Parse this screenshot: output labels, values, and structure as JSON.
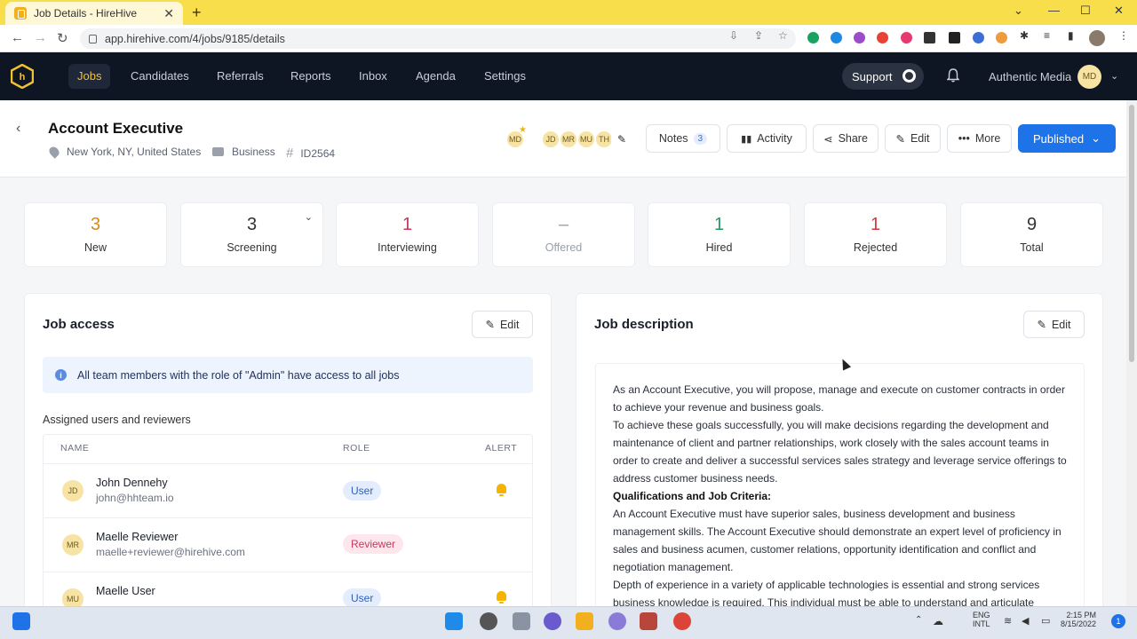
{
  "browser": {
    "tab_title": "Job Details - HireHive",
    "url": "app.hirehive.com/4/jobs/9185/details"
  },
  "nav": {
    "items": [
      "Jobs",
      "Candidates",
      "Referrals",
      "Reports",
      "Inbox",
      "Agenda",
      "Settings"
    ],
    "support_label": "Support",
    "org_name": "Authentic Media",
    "user_initials": "MD",
    "accent": "#f5c02f"
  },
  "job": {
    "title": "Account Executive",
    "location": "New York, NY, United States",
    "department": "Business",
    "job_id": "ID2564",
    "hiring_team": [
      "MD",
      "JD",
      "MR",
      "MU",
      "TH"
    ],
    "notes_label": "Notes",
    "notes_count": "3",
    "activity_label": "Activity",
    "share_label": "Share",
    "edit_label": "Edit",
    "more_label": "More",
    "status_label": "Published"
  },
  "pipeline": [
    {
      "count": "3",
      "label": "New",
      "color": "#d68a1c"
    },
    {
      "count": "3",
      "label": "Screening",
      "color": "#333333"
    },
    {
      "count": "1",
      "label": "Interviewing",
      "color": "#c7375b"
    },
    {
      "count": "–",
      "label": "Offered",
      "color": "#9aa0aa"
    },
    {
      "count": "1",
      "label": "Hired",
      "color": "#1f9a63"
    },
    {
      "count": "1",
      "label": "Rejected",
      "color": "#d23b3b"
    },
    {
      "count": "9",
      "label": "Total",
      "color": "#333333"
    }
  ],
  "job_access": {
    "title": "Job access",
    "edit_label": "Edit",
    "info": "All team members with the role of \"Admin\" have access to all jobs",
    "subtitle": "Assigned users and reviewers",
    "columns": [
      "NAME",
      "ROLE",
      "ALERT"
    ],
    "users": [
      {
        "initials": "JD",
        "name": "John Dennehy",
        "email": "john@hhteam.io",
        "role": "User"
      },
      {
        "initials": "MR",
        "name": "Maelle Reviewer",
        "email": "maelle+reviewer@hirehive.com",
        "role": "Reviewer"
      },
      {
        "initials": "MU",
        "name": "Maelle User",
        "email": "",
        "role": "User"
      }
    ]
  },
  "job_description": {
    "title": "Job description",
    "edit_label": "Edit",
    "p1": "As an Account Executive, you will propose, manage and execute on customer contracts in order to achieve your revenue and business goals.",
    "p2": "To achieve these goals successfully, you will make decisions regarding the development and maintenance of client and partner relationships, work closely with the sales account teams in order to create and deliver a successful services sales strategy and leverage service offerings to address customer business needs.",
    "heading": "Qualifications and Job Criteria:",
    "p3": "An Account Executive must have superior sales, business development and business management skills. The Account Executive should demonstrate an expert level of proficiency in sales and business acumen, customer relations, opportunity identification and conflict and negotiation management.",
    "p4": "Depth of experience in a variety of applicable technologies is essential and strong services business knowledge is required. This individual must be able to understand and articulate"
  },
  "taskbar": {
    "language": "ENG",
    "layout": "INTL",
    "time": "2:15 PM",
    "date": "8/15/2022",
    "notifications": "1"
  }
}
